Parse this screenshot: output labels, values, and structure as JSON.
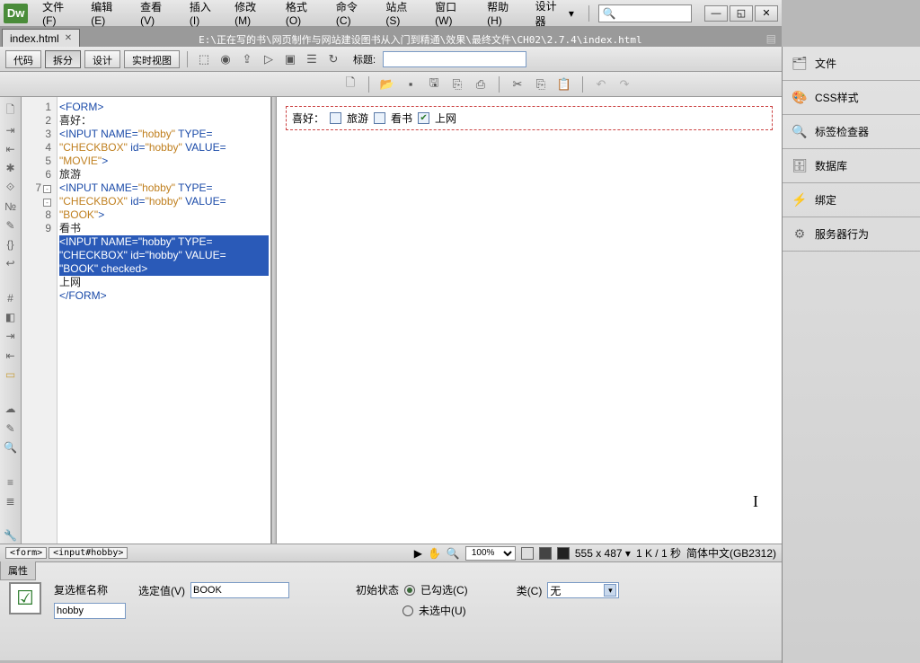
{
  "app": {
    "logo": "Dw"
  },
  "menu": {
    "file": "文件(F)",
    "edit": "编辑(E)",
    "view": "查看(V)",
    "insert": "插入(I)",
    "modify": "修改(M)",
    "format": "格式(O)",
    "command": "命令(C)",
    "site": "站点(S)",
    "window": "窗口(W)",
    "help": "帮助(H)",
    "designer": "设计器"
  },
  "tab": {
    "name": "index.html"
  },
  "path": "E:\\正在写的书\\网页制作与网站建设图书从入门到精通\\效果\\最终文件\\CH02\\2.7.4\\index.html",
  "views": {
    "code": "代码",
    "split": "拆分",
    "design": "设计",
    "live": "实时视图"
  },
  "title_label": "标题:",
  "code_lines": {
    "l1": "<FORM>",
    "l2": "喜好：",
    "l3a": "<INPUT NAME=",
    "l3b": "\"hobby\"",
    "l3c": " TYPE=",
    "l3d": "\"CHECKBOX\"",
    "l3e": " id=",
    "l3f": "\"hobby\"",
    "l3g": " VALUE=",
    "l3h": "\"MOVIE\"",
    "l3i": ">",
    "l4": "旅游",
    "l5a": "<INPUT NAME=",
    "l5b": "\"hobby\"",
    "l5c": " TYPE=",
    "l5d": "\"CHECKBOX\"",
    "l5e": " id=",
    "l5f": "\"hobby\"",
    "l5g": " VALUE=",
    "l5h": "\"BOOK\"",
    "l5i": ">",
    "l6": "看书",
    "l7a": "<INPUT NAME=",
    "l7b": "\"hobby\"",
    "l7c": " TYPE=",
    "l7d": "\"CHECKBOX\"",
    "l7e": " id=",
    "l7f": "\"hobby\"",
    "l7g": " VALUE=",
    "l7h": "\"BOOK\"",
    "l7i": " checked>",
    "l8": "上网",
    "l9": "</FORM>"
  },
  "line_nums": [
    "1",
    "2",
    "3",
    "",
    "4",
    "5",
    "",
    "6",
    "7",
    "",
    "8",
    "9"
  ],
  "preview": {
    "label": "喜好：",
    "opt1": "旅游",
    "opt2": "看书",
    "opt3": "上网"
  },
  "panels": {
    "files": "文件",
    "css": "CSS样式",
    "tag": "标签检查器",
    "db": "数据库",
    "bind": "绑定",
    "server": "服务器行为"
  },
  "status": {
    "sel1": "<form>",
    "sel2": "<input#hobby>",
    "zoom": "100%",
    "dims": "555 x 487",
    "size": "1 K / 1 秒",
    "enc": "简体中文(GB2312)"
  },
  "props": {
    "tab": "属性",
    "name_label": "复选框名称",
    "name_value": "hobby",
    "sel_label": "选定值(V)",
    "sel_value": "BOOK",
    "init_label": "初始状态",
    "init_checked": "已勾选(C)",
    "init_unchecked": "未选中(U)",
    "class_label": "类(C)",
    "class_value": "无"
  }
}
